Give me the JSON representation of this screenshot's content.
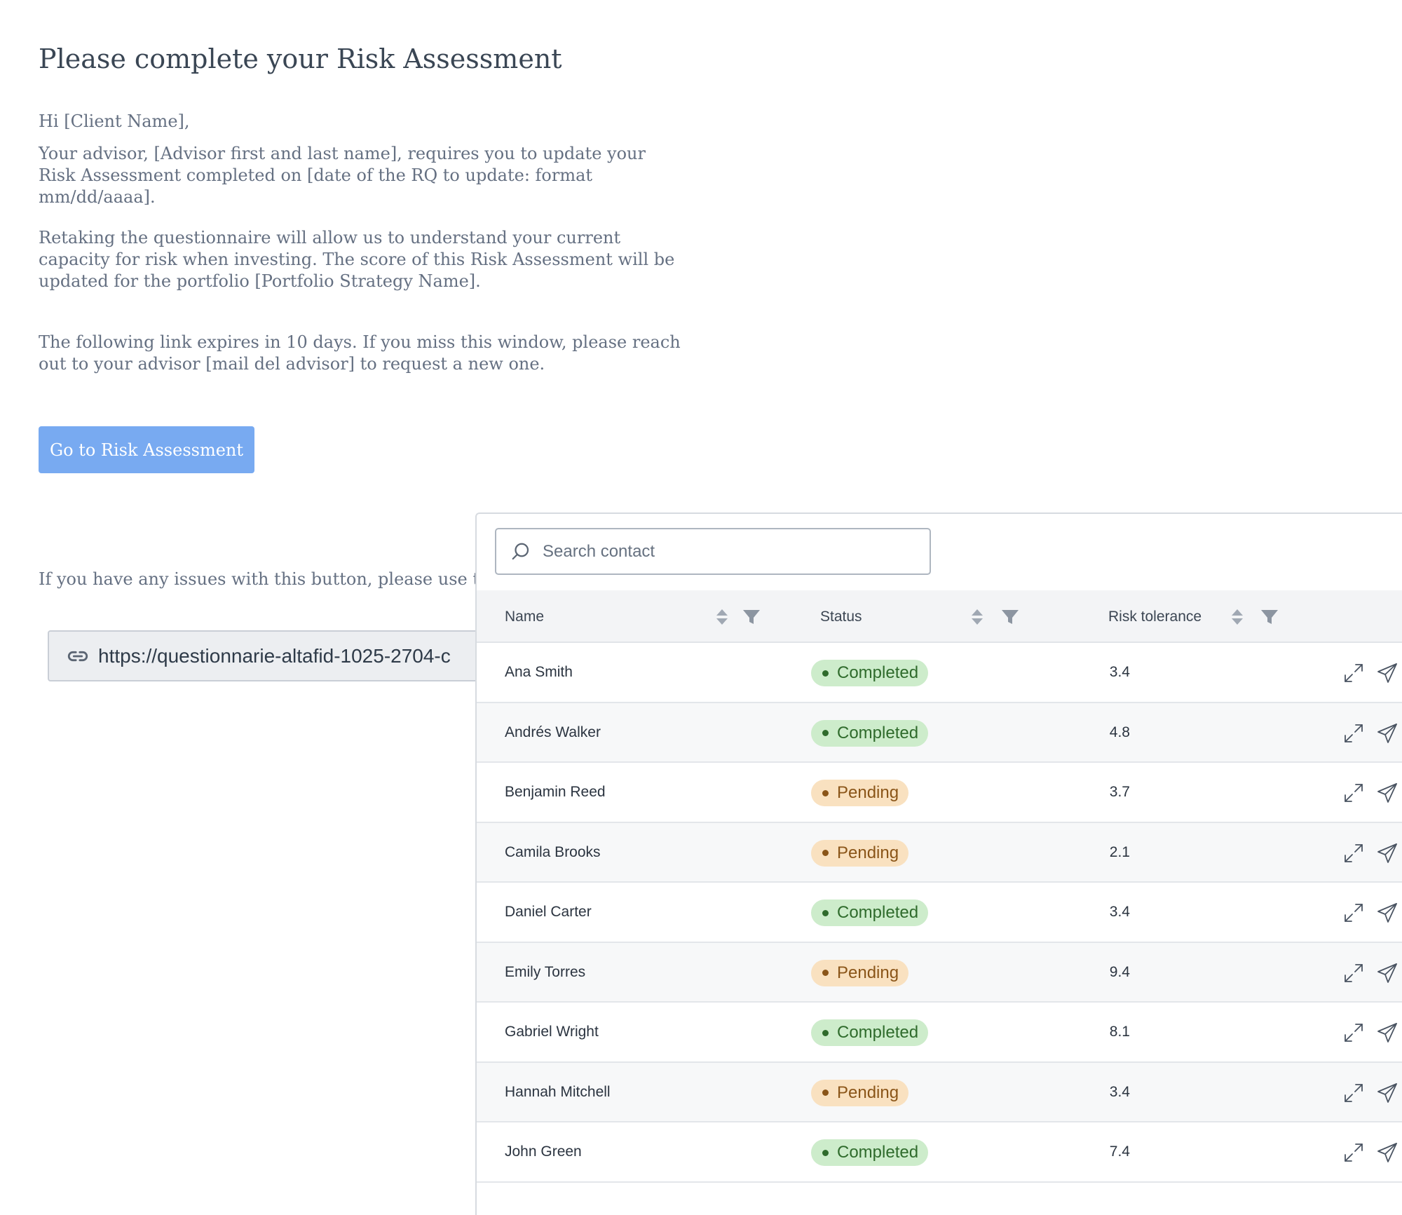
{
  "email": {
    "title": "Please complete your Risk Assessment",
    "greeting": "Hi [Client Name],",
    "paragraph1": "Your advisor, [Advisor first and last name], requires you to update your Risk Assessment completed on [date of the RQ to update: format mm/dd/aaaa].",
    "paragraph2": "Retaking the questionnaire will allow us to understand your current capacity for risk when investing. The score of this Risk Assessment will be updated for the portfolio [Portfolio Strategy Name].",
    "paragraph3": "The following link expires in 10 days. If you miss this window, please reach out to your advisor [mail del advisor] to request a new one.",
    "cta_label": "Go to Risk Assessment",
    "fallback_text": "If you have any issues with this button, please use the fo",
    "link_url": "https://questionnarie-altafid-1025-2704-c"
  },
  "contacts": {
    "search_placeholder": "Search contact",
    "columns": {
      "name": "Name",
      "status": "Status",
      "risk": "Risk tolerance"
    },
    "rows": [
      {
        "name": "Ana Smith",
        "status": "Completed",
        "risk": "3.4"
      },
      {
        "name": "Andrés Walker",
        "status": "Completed",
        "risk": "4.8"
      },
      {
        "name": "Benjamin Reed",
        "status": "Pending",
        "risk": "3.7"
      },
      {
        "name": "Camila Brooks",
        "status": "Pending",
        "risk": "2.1"
      },
      {
        "name": "Daniel Carter",
        "status": "Completed",
        "risk": "3.4"
      },
      {
        "name": "Emily Torres",
        "status": "Pending",
        "risk": "9.4"
      },
      {
        "name": "Gabriel Wright",
        "status": "Completed",
        "risk": "8.1"
      },
      {
        "name": "Hannah Mitchell",
        "status": "Pending",
        "risk": "3.4"
      },
      {
        "name": "John Green",
        "status": "Completed",
        "risk": "7.4"
      }
    ],
    "row_icons": [
      "expand-icon",
      "send-icon"
    ]
  },
  "colors": {
    "cta_background": "#78aaf1",
    "completed_bg": "#cdeccb",
    "completed_text": "#2f6b2c",
    "pending_bg": "#f9e1c0",
    "pending_text": "#8a5518"
  }
}
